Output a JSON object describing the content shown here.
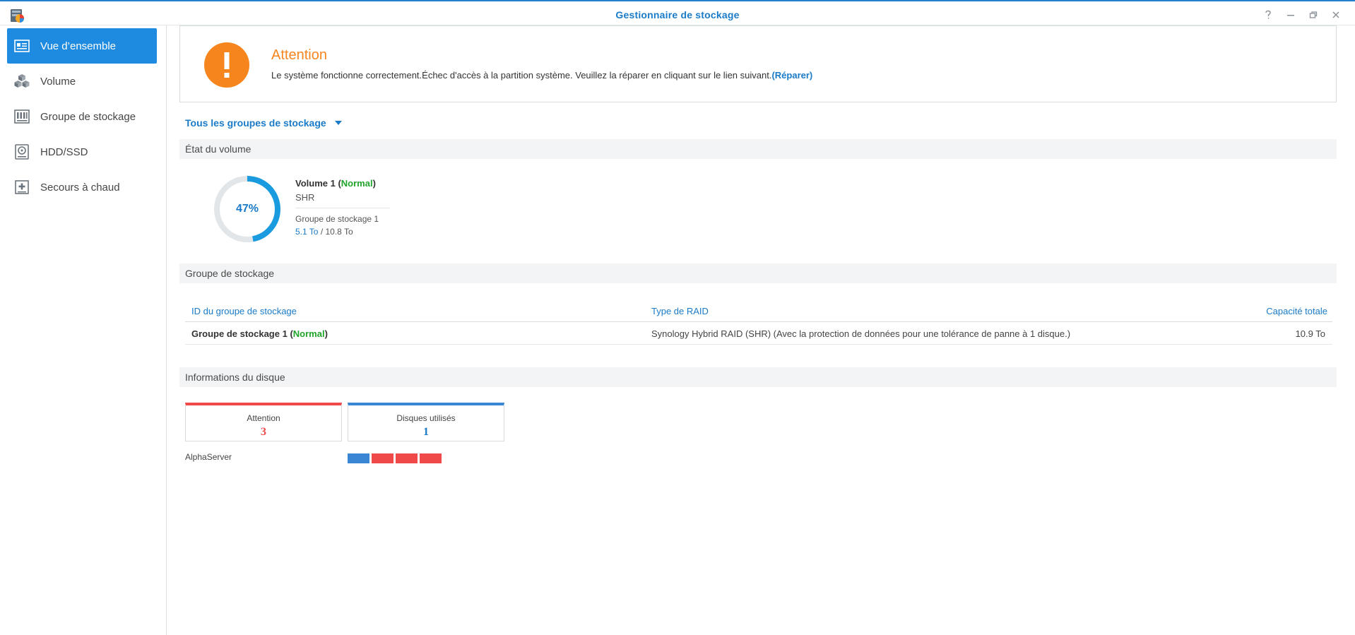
{
  "window": {
    "title": "Gestionnaire de stockage",
    "accent": "#2580c9"
  },
  "window_controls": [
    {
      "name": "help-icon"
    },
    {
      "name": "minimize-icon"
    },
    {
      "name": "restore-icon"
    },
    {
      "name": "close-icon"
    }
  ],
  "sidebar": {
    "items": [
      {
        "label": "Vue d’ensemble",
        "icon": "overview-icon",
        "active": true
      },
      {
        "label": "Volume",
        "icon": "volume-cubes-icon",
        "active": false
      },
      {
        "label": "Groupe de stockage",
        "icon": "storage-pool-icon",
        "active": false
      },
      {
        "label": "HDD/SSD",
        "icon": "hdd-icon",
        "active": false
      },
      {
        "label": "Secours à chaud",
        "icon": "hot-spare-icon",
        "active": false
      }
    ]
  },
  "alert": {
    "title": "Attention",
    "message": "Le système fonctionne correctement.Échec d'accès à la partition système. Veuillez la réparer en cliquant sur le lien suivant.",
    "link_label": "(Réparer)",
    "color": "#f7851e"
  },
  "group_selector": {
    "label": "Tous les groupes de stockage"
  },
  "volume_section": {
    "title": "État du volume",
    "usage_percent": 47,
    "usage_label": "47%",
    "name": "Volume 1",
    "status": "Normal",
    "raid_type": "SHR",
    "pool": "Groupe de stockage 1",
    "used": "5.1 To",
    "separator": " / ",
    "total": "10.8 To"
  },
  "pool_section": {
    "title": "Groupe de stockage",
    "columns": [
      "ID du groupe de stockage",
      "Type de RAID",
      "Capacité totale"
    ],
    "rows": [
      {
        "id": "Groupe de stockage 1",
        "status": "Normal",
        "raid": "Synology Hybrid RAID (SHR) (Avec la protection de données pour une tolérance de panne à 1 disque.)",
        "capacity": "10.9 To"
      }
    ]
  },
  "disk_section": {
    "title": "Informations du disque",
    "cards": [
      {
        "label": "Attention",
        "value": "3",
        "color": "#f0494a"
      },
      {
        "label": "Disques utilisés",
        "value": "1",
        "color": "#3a86d4"
      }
    ],
    "server": "AlphaServer",
    "slots": [
      {
        "state": "normal",
        "color": "#3a86d4"
      },
      {
        "state": "warning",
        "color": "#f0494a"
      },
      {
        "state": "warning",
        "color": "#f0494a"
      },
      {
        "state": "warning",
        "color": "#f0494a"
      }
    ]
  }
}
